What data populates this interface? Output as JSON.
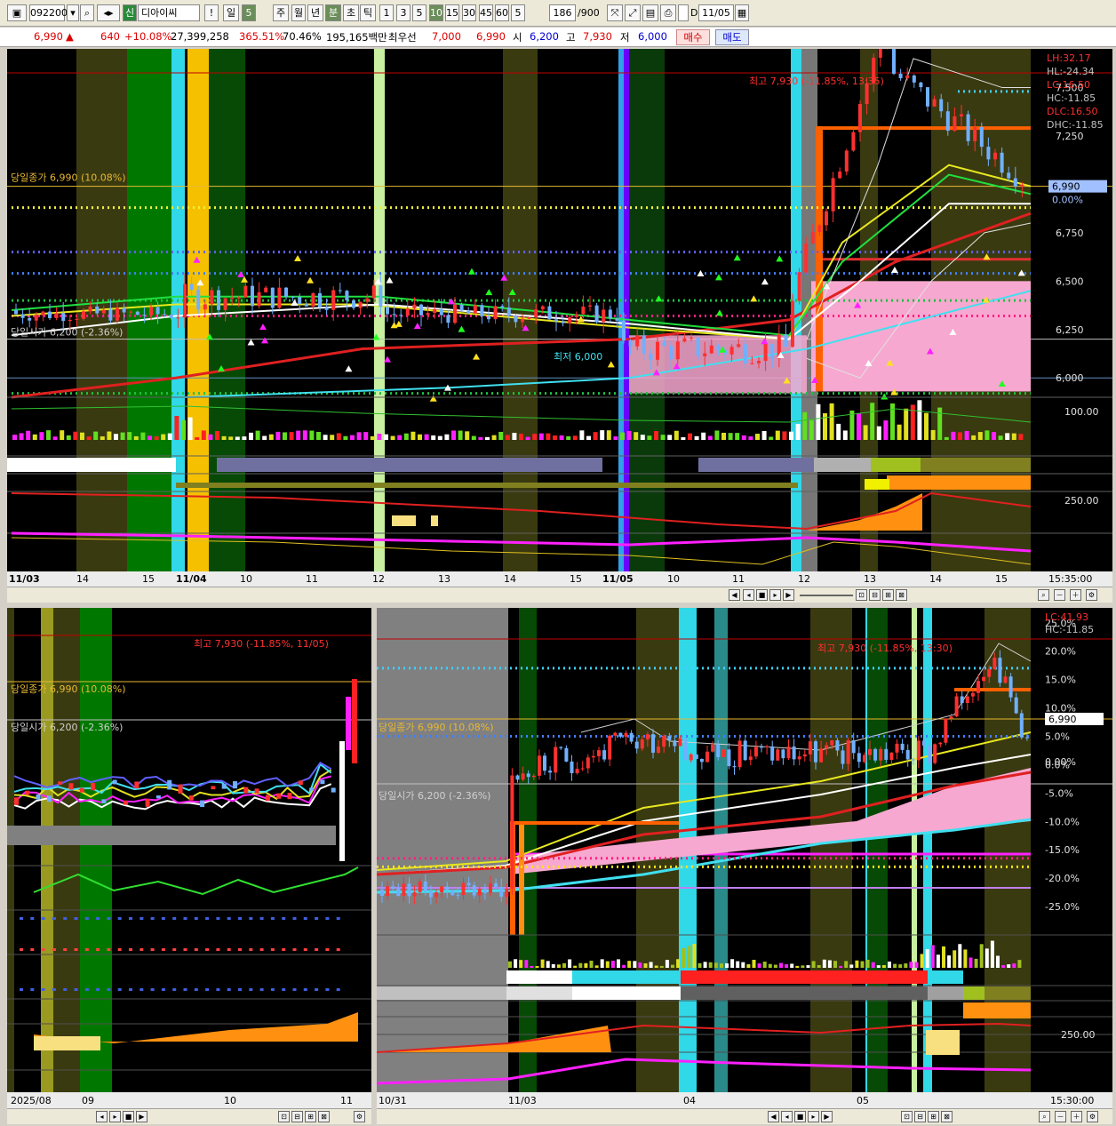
{
  "toolbar": {
    "code": "092200",
    "badge": "신",
    "name": "디아이씨",
    "period_buttons": [
      "일",
      "5",
      "주",
      "월",
      "년",
      "분",
      "초",
      "틱",
      "1",
      "3",
      "5",
      "10",
      "15",
      "30",
      "45",
      "60",
      "5"
    ],
    "count": "186",
    "count_max": "/900",
    "date": "11/05",
    "d_label": "D"
  },
  "info": {
    "price": "6,990",
    "change": "640",
    "change_pct": "+10.08%",
    "volume": "27,399,258",
    "vol_ratio": "365.51%",
    "turnover_pct": "70.46%",
    "amount": "195,165백만",
    "best_label": "최우선",
    "best_ask": "7,000",
    "best_bid": "6,990",
    "open_label": "시",
    "open": "6,200",
    "high_label": "고",
    "high": "7,930",
    "low_label": "저",
    "low": "6,000",
    "buy": "매수",
    "sell": "매도"
  },
  "main_chart": {
    "legend": [
      {
        "text": "LH:32.17",
        "color": "#ff3030"
      },
      {
        "text": "HL:-24.34",
        "color": "#c0c0c0"
      },
      {
        "text": "LC:16.50",
        "color": "#ff3030"
      },
      {
        "text": "HC:-11.85",
        "color": "#c0c0c0"
      },
      {
        "text": "DLC:16.50",
        "color": "#ff3030"
      },
      {
        "text": "DHC:-11.85",
        "color": "#c0c0c0"
      }
    ],
    "high_annotation": "최고 7,930 (-11.85%, 13:35)",
    "low_annotation": "최저 6,000",
    "close_label": "당일종가 6,990 (10.08%)",
    "open_label": "당일시가 6,200 (-2.36%)",
    "price_ticks": [
      "7,500",
      "7,250",
      "6,750",
      "6,500",
      "6,250",
      "6,000"
    ],
    "current_price": "6,990",
    "current_pct": "0.00%",
    "volume_tick": "100.00",
    "osc_tick": "250.00",
    "time_labels": [
      "11/03",
      "14",
      "15",
      "11/04",
      "10",
      "11",
      "12",
      "13",
      "14",
      "15",
      "11/05",
      "10",
      "11",
      "12",
      "13",
      "14",
      "15"
    ],
    "time_end": "15:35:00"
  },
  "daily_chart": {
    "high_annotation": "최고 7,930 (-11.85%, 11/05)",
    "close_label": "당일종가 6,990 (10.08%)",
    "open_label": "당일시가 6,200 (-2.36%)",
    "time_labels": [
      "2025/08",
      "09",
      "10",
      "11"
    ]
  },
  "pct_chart": {
    "legend": [
      {
        "text": "LC:41.93",
        "color": "#ff3030"
      },
      {
        "text": "HC:-11.85",
        "color": "#c0c0c0"
      }
    ],
    "high_annotation": "최고 7,930 (-11.85%, 13:30)",
    "close_label": "당일종가 6,990 (10.08%)",
    "open_label": "당일시가 6,200 (-2.36%)",
    "pct_ticks": [
      "25.0%",
      "20.0%",
      "15.0%",
      "10.0%",
      "5.0%",
      "0.00%",
      "0.0%",
      "-5.0%",
      "-10.0%",
      "-15.0%",
      "-20.0%",
      "-25.0%"
    ],
    "current_price": "6,990",
    "osc_tick": "250.00",
    "time_labels": [
      "10/31",
      "11/03",
      "04",
      "05"
    ],
    "time_end": "15:30:00"
  },
  "chart_data": [
    {
      "type": "candlestick",
      "title": "",
      "x": [
        "11/03",
        "11/04",
        "11/05"
      ],
      "open": [
        6400,
        6350,
        6200
      ],
      "high": [
        6450,
        6550,
        7930
      ],
      "low": [
        6250,
        6250,
        6000
      ],
      "close": [
        6350,
        6350,
        6990
      ],
      "ylim": [
        5900,
        7700
      ],
      "reference_lines": {
        "today_close": 6990,
        "today_open": 6200
      }
    },
    {
      "type": "line",
      "title": "",
      "x": [
        "2025/08",
        "09",
        "10",
        "11"
      ],
      "y": [
        5900,
        6100,
        6300,
        6990
      ],
      "ylim": [
        5000,
        8500
      ]
    }
  ]
}
